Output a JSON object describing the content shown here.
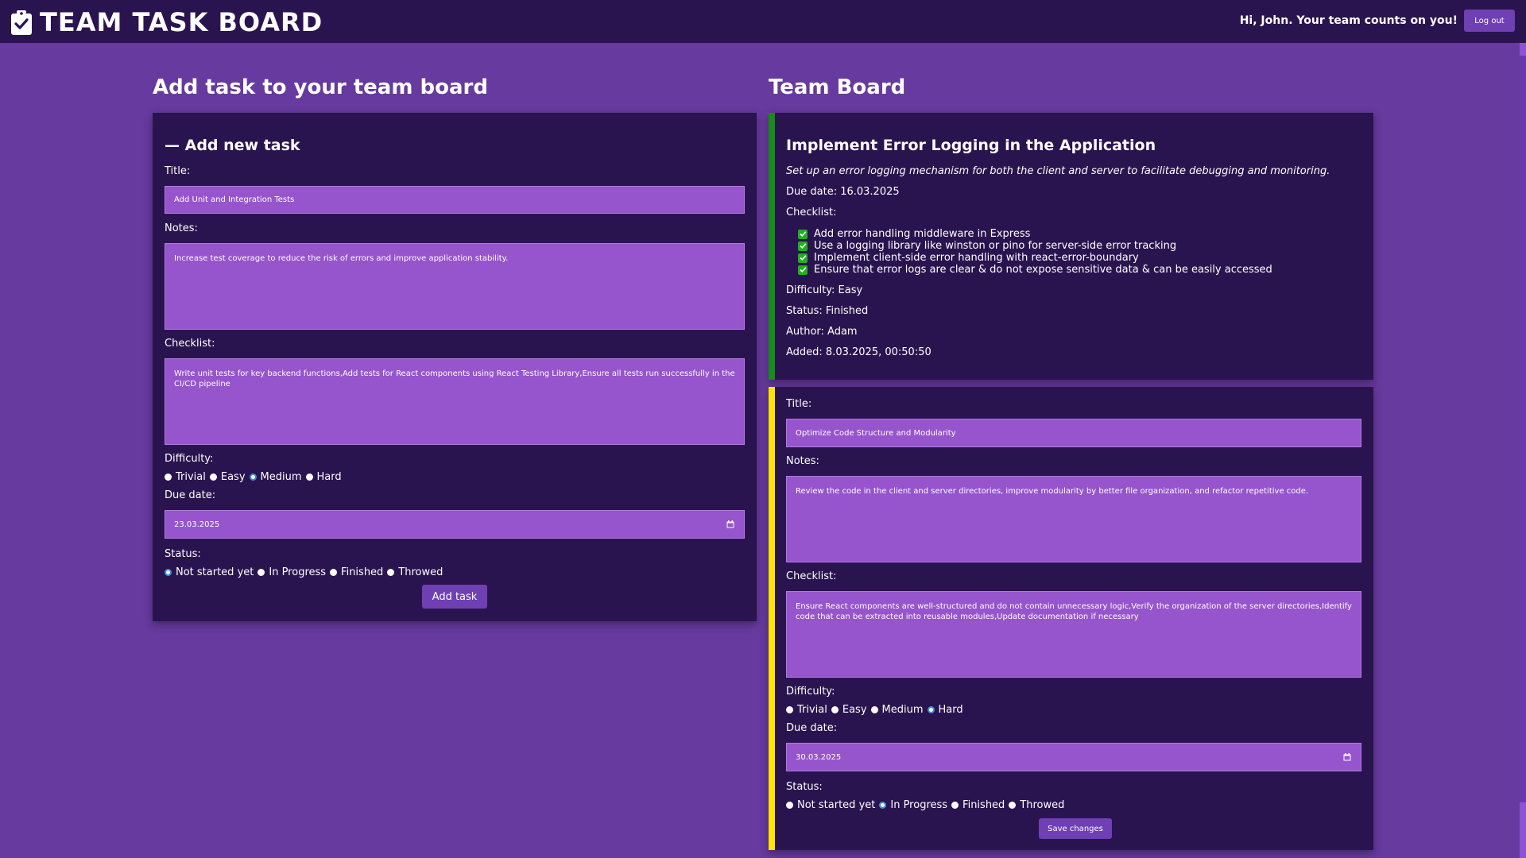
{
  "header": {
    "app_title": "TEAM TASK BOARD",
    "greeting": "Hi, John. Your team counts on you!",
    "logout_label": "Log out"
  },
  "left": {
    "heading": "Add task to your team board",
    "card_title": "— Add new task",
    "title_label": "Title:",
    "title_value": "Add Unit and Integration Tests",
    "notes_label": "Notes:",
    "notes_value": "Increase test coverage to reduce the risk of errors and improve application stability.",
    "checklist_label": "Checklist:",
    "checklist_value": "Write unit tests for key backend functions,Add tests for React components using React Testing Library,Ensure all tests run successfully in the CI/CD pipeline",
    "difficulty_label": "Difficulty:",
    "difficulty_options": [
      "Trivial",
      "Easy",
      "Medium",
      "Hard"
    ],
    "difficulty_selected": "Medium",
    "due_label": "Due date:",
    "due_value": "23.03.2025",
    "status_label": "Status:",
    "status_options": [
      "Not started yet",
      "In Progress",
      "Finished",
      "Throwed"
    ],
    "status_selected": "Not started yet",
    "submit_label": "Add task"
  },
  "board": {
    "heading": "Team Board",
    "task1": {
      "title": "Implement Error Logging in the Application",
      "description": "Set up an error logging mechanism for both the client and server to facilitate debugging and monitoring.",
      "due": "Due date: 16.03.2025",
      "checklist_label": "Checklist:",
      "checklist": [
        "Add error handling middleware in Express",
        "Use a logging library like winston or pino for server-side error tracking",
        "Implement client-side error handling with react-error-boundary",
        "Ensure that error logs are clear & do not expose sensitive data & can be easily accessed"
      ],
      "difficulty": "Difficulty: Easy",
      "status": "Status: Finished",
      "author": "Author: Adam",
      "added": "Added: 8.03.2025, 00:50:50",
      "accent_color": "#1a8a1a"
    },
    "task2": {
      "title_label": "Title:",
      "title_value": "Optimize Code Structure and Modularity",
      "notes_label": "Notes:",
      "notes_value": "Review the code in the client and server directories, improve modularity by better file organization, and refactor repetitive code.",
      "checklist_label": "Checklist:",
      "checklist_value": "Ensure React components are well-structured and do not contain unnecessary logic,Verify the organization of the server directories,Identify code that can be extracted into reusable modules,Update documentation if necessary",
      "difficulty_label": "Difficulty:",
      "difficulty_options": [
        "Trivial",
        "Easy",
        "Medium",
        "Hard"
      ],
      "difficulty_selected": "Hard",
      "due_label": "Due date:",
      "due_value": "30.03.2025",
      "status_label": "Status:",
      "status_options": [
        "Not started yet",
        "In Progress",
        "Finished",
        "Throwed"
      ],
      "status_selected": "In Progress",
      "save_label": "Save changes",
      "accent_color": "#ffe500"
    }
  },
  "colors": {
    "page_bg": "#663a9e",
    "panel_bg": "#2a1450",
    "field_bg": "#9655cc",
    "button_bg": "#6f3fb4",
    "radio_selected": "#3a8ee8",
    "check_green": "#1fb01f"
  },
  "icons": {
    "logo": "clipboard-check-icon",
    "date": "calendar-icon",
    "check": "checkbox-checked-icon"
  }
}
